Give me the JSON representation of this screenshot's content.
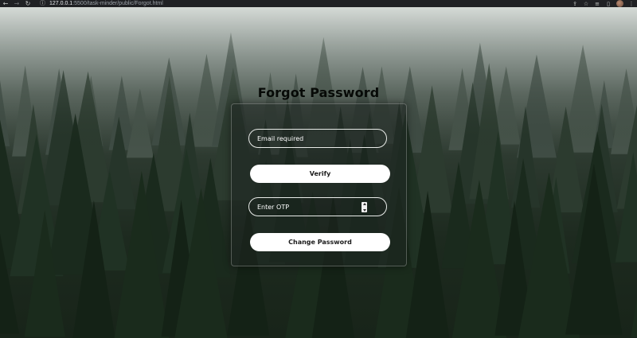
{
  "browser": {
    "url_host": "127.0.0.1",
    "url_path": ":5500/task-minder/public/Forgot.html",
    "icons": [
      "back-arrow-icon",
      "forward-arrow-icon",
      "reload-icon",
      "site-info-icon",
      "share-icon",
      "star-icon",
      "extension-icon",
      "sidepanel-icon",
      "avatar",
      "kebab-menu-icon"
    ]
  },
  "page": {
    "title": "Forgot Password",
    "email": {
      "placeholder": "Email required"
    },
    "verify_label": "Verify",
    "otp": {
      "placeholder": "Enter OTP"
    },
    "change_label": "Change Password"
  },
  "colors": {
    "card_border": "#ffffff40",
    "button_bg": "#ffffff",
    "button_text": "#1c1c1c",
    "title": "#070a07",
    "toolbar_bg": "#202124"
  }
}
